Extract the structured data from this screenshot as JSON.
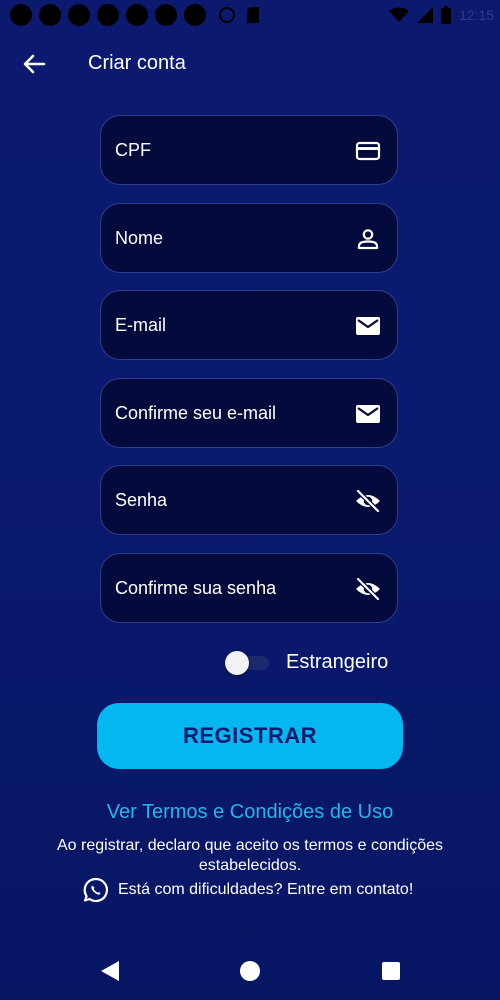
{
  "status_bar": {
    "time": "12:15",
    "icons": [
      "notification-dot",
      "notification-dot",
      "notification-dot",
      "notification-dot",
      "notification-dot",
      "notification-dot",
      "notification-dot",
      "data-saver-icon",
      "sd-card-icon",
      "wifi-icon",
      "signal-icon",
      "battery-icon"
    ]
  },
  "header": {
    "back_icon": "arrow-left-icon",
    "title": "Criar conta"
  },
  "form": {
    "fields": [
      {
        "label": "CPF",
        "icon": "credit-card-icon"
      },
      {
        "label": "Nome",
        "icon": "person-icon"
      },
      {
        "label": "E-mail",
        "icon": "envelope-icon"
      },
      {
        "label": "Confirme seu e-mail",
        "icon": "envelope-icon"
      },
      {
        "label": "Senha",
        "icon": "eye-off-icon"
      },
      {
        "label": "Confirme sua senha",
        "icon": "eye-off-icon"
      }
    ],
    "foreigner_toggle": {
      "label": "Estrangeiro",
      "checked": false
    },
    "register_label": "REGISTRAR"
  },
  "footer": {
    "terms_link": "Ver Termos e Condições de Uso",
    "disclaimer": "Ao registrar, declaro que aceito os termos e condições estabelecidos.",
    "contact_text": "Está com dificuldades? Entre em contato!",
    "contact_icon": "whatsapp-icon"
  },
  "nav_bar": {
    "icons": [
      "nav-back-icon",
      "nav-home-icon",
      "nav-recents-icon"
    ]
  },
  "colors": {
    "background": "#0a1a70",
    "field_background": "#040b3c",
    "field_border": "#2e3d8a",
    "accent": "#05b7f1",
    "link": "#2ab3ea",
    "button_text": "#0d1b6e"
  }
}
